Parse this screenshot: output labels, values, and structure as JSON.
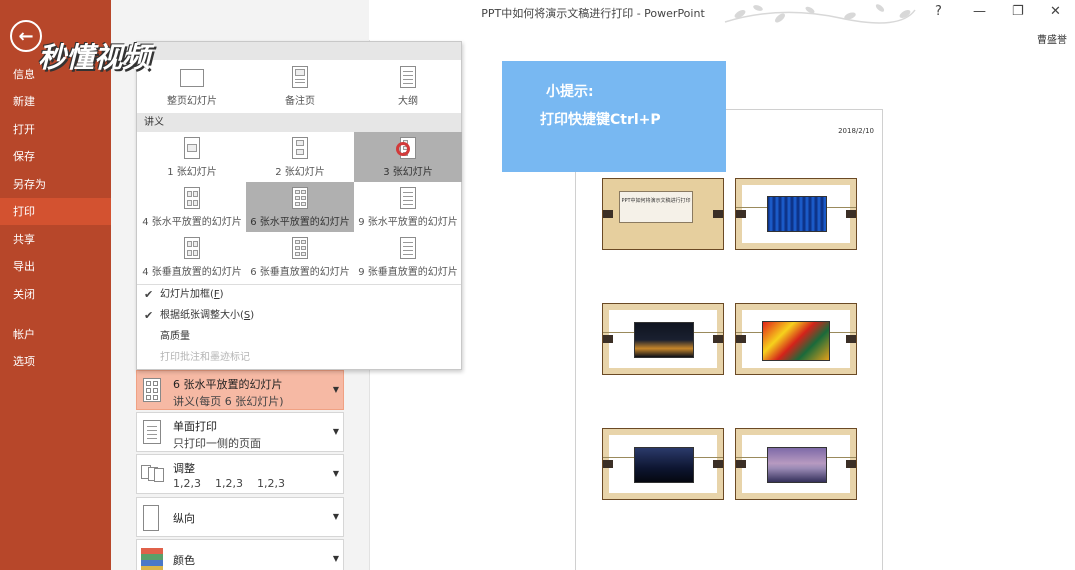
{
  "window": {
    "title": "PPT中如何将演示文稿进行打印 - PowerPoint",
    "user": "曹盛誉",
    "controls": {
      "help": "?",
      "minimize": "—",
      "restore": "❐",
      "close": "✕"
    }
  },
  "watermark": "秒懂视频",
  "sidebar": {
    "back_icon": "←",
    "items": [
      {
        "label": "信息"
      },
      {
        "label": "新建"
      },
      {
        "label": "打开"
      },
      {
        "label": "保存"
      },
      {
        "label": "另存为"
      },
      {
        "label": "打印",
        "active": true
      },
      {
        "label": "共享"
      },
      {
        "label": "导出"
      },
      {
        "label": "关闭"
      },
      {
        "label": "帐户"
      },
      {
        "label": "选项"
      }
    ]
  },
  "layout_menu": {
    "top_row": [
      {
        "label": "整页幻灯片",
        "icon": "full-page-icon"
      },
      {
        "label": "备注页",
        "icon": "notes-page-icon"
      },
      {
        "label": "大纲",
        "icon": "outline-icon"
      }
    ],
    "handouts_header": "讲义",
    "handouts": [
      {
        "label": "1 张幻灯片",
        "icon": "handout-1-icon"
      },
      {
        "label": "2 张幻灯片",
        "icon": "handout-2-icon"
      },
      {
        "label": "3 张幻灯片",
        "icon": "handout-3-icon",
        "hover": true
      },
      {
        "label": "4 张水平放置的幻灯片",
        "icon": "handout-4h-icon"
      },
      {
        "label": "6 张水平放置的幻灯片",
        "icon": "handout-6h-icon",
        "selected": true
      },
      {
        "label": "9 张水平放置的幻灯片",
        "icon": "handout-9h-icon"
      },
      {
        "label": "4 张垂直放置的幻灯片",
        "icon": "handout-4v-icon"
      },
      {
        "label": "6 张垂直放置的幻灯片",
        "icon": "handout-6v-icon"
      },
      {
        "label": "9 张垂直放置的幻灯片",
        "icon": "handout-9v-icon"
      }
    ],
    "options": [
      {
        "label": "幻灯片加框(",
        "key": "F",
        "suffix": ")",
        "checked": true
      },
      {
        "label": "根据纸张调整大小(",
        "key": "S",
        "suffix": ")",
        "checked": true
      },
      {
        "label": "高质量",
        "key": "",
        "suffix": "",
        "checked": false
      },
      {
        "label": "打印批注和墨迹标记",
        "key": "",
        "suffix": "",
        "checked": false,
        "disabled": true
      }
    ]
  },
  "settings": [
    {
      "title": "6 张水平放置的幻灯片",
      "subtitle": "讲义(每页 6 张幻灯片)",
      "icon": "handout-6h-icon",
      "highlighted": true
    },
    {
      "title": "单面打印",
      "subtitle": "只打印一侧的页面",
      "icon": "single-sided-icon"
    },
    {
      "title": "调整",
      "subtitle": "1,2,3    1,2,3    1,2,3",
      "icon": "collate-icon"
    },
    {
      "title": "纵向",
      "subtitle": "",
      "icon": "portrait-icon"
    },
    {
      "title": "颜色",
      "subtitle": "",
      "icon": "color-icon"
    }
  ],
  "tip": {
    "title": "小提示:",
    "body": "打印快捷键Ctrl+P"
  },
  "preview": {
    "date": "2018/2/10",
    "title_slide_text": "PPT中如何将演示文稿进行打印",
    "slides": [
      {
        "name": "title-slide"
      },
      {
        "name": "blue-curtain-slide"
      },
      {
        "name": "city-night-slide"
      },
      {
        "name": "red-abstract-slide"
      },
      {
        "name": "city-silhouette-slide"
      },
      {
        "name": "purple-sky-slide"
      }
    ]
  },
  "colors": {
    "sidebar": "#b7472a",
    "sidebar_active": "#d35230",
    "tip_bg": "#78b8f2",
    "setting_highlight": "#f6b9a4"
  }
}
